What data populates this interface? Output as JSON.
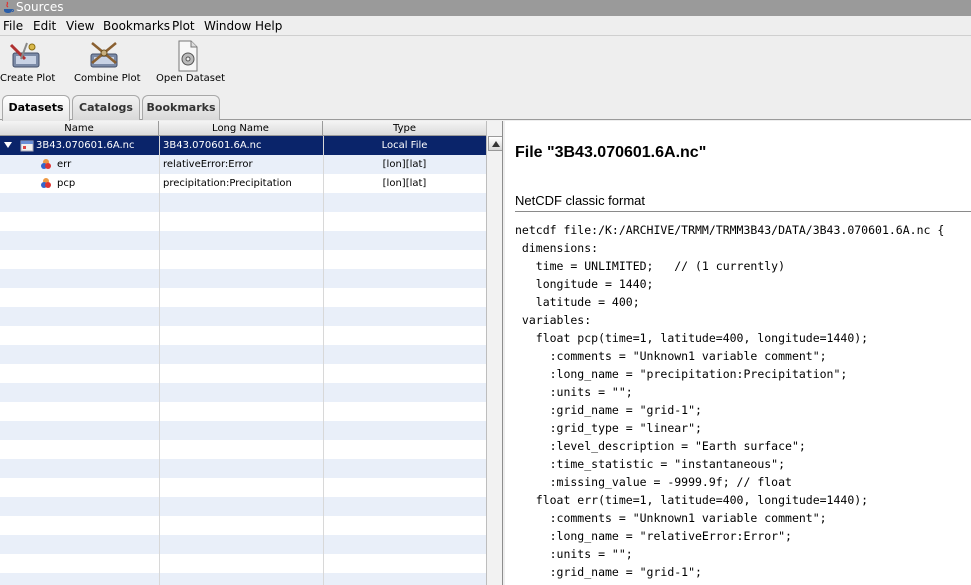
{
  "window": {
    "title": "Sources"
  },
  "menu": [
    "File",
    "Edit",
    "View",
    "Bookmarks",
    "Plot",
    "Window",
    "Help"
  ],
  "toolbar": {
    "create_plot": "Create Plot",
    "combine_plot": "Combine Plot",
    "open_dataset": "Open Dataset"
  },
  "tabs": [
    "Datasets",
    "Catalogs",
    "Bookmarks"
  ],
  "table": {
    "columns": [
      "Name",
      "Long Name",
      "Type"
    ],
    "rows": [
      {
        "name": "3B43.070601.6A.nc",
        "long_name": "3B43.070601.6A.nc",
        "type": "Local File"
      },
      {
        "name": "err",
        "long_name": "relativeError:Error",
        "type": "[lon][lat]"
      },
      {
        "name": "pcp",
        "long_name": "precipitation:Precipitation",
        "type": "[lon][lat]"
      }
    ]
  },
  "detail": {
    "file_title": "File \"3B43.070601.6A.nc\"",
    "format": "NetCDF classic format",
    "cdl_lines": [
      "netcdf file:/K:/ARCHIVE/TRMM/TRMM3B43/DATA/3B43.070601.6A.nc {",
      " dimensions:",
      "   time = UNLIMITED;   // (1 currently)",
      "   longitude = 1440;",
      "   latitude = 400;",
      " variables:",
      "   float pcp(time=1, latitude=400, longitude=1440);",
      "     :comments = \"Unknown1 variable comment\";",
      "     :long_name = \"precipitation:Precipitation\";",
      "     :units = \"\";",
      "     :grid_name = \"grid-1\";",
      "     :grid_type = \"linear\";",
      "     :level_description = \"Earth surface\";",
      "     :time_statistic = \"instantaneous\";",
      "     :missing_value = -9999.9f; // float",
      "   float err(time=1, latitude=400, longitude=1440);",
      "     :comments = \"Unknown1 variable comment\";",
      "     :long_name = \"relativeError:Error\";",
      "     :units = \"\";",
      "     :grid_name = \"grid-1\";"
    ]
  },
  "colors": {
    "selection": "#0a246a",
    "stripe": "#e9eff9",
    "titlebar": "#9a9a9a"
  }
}
